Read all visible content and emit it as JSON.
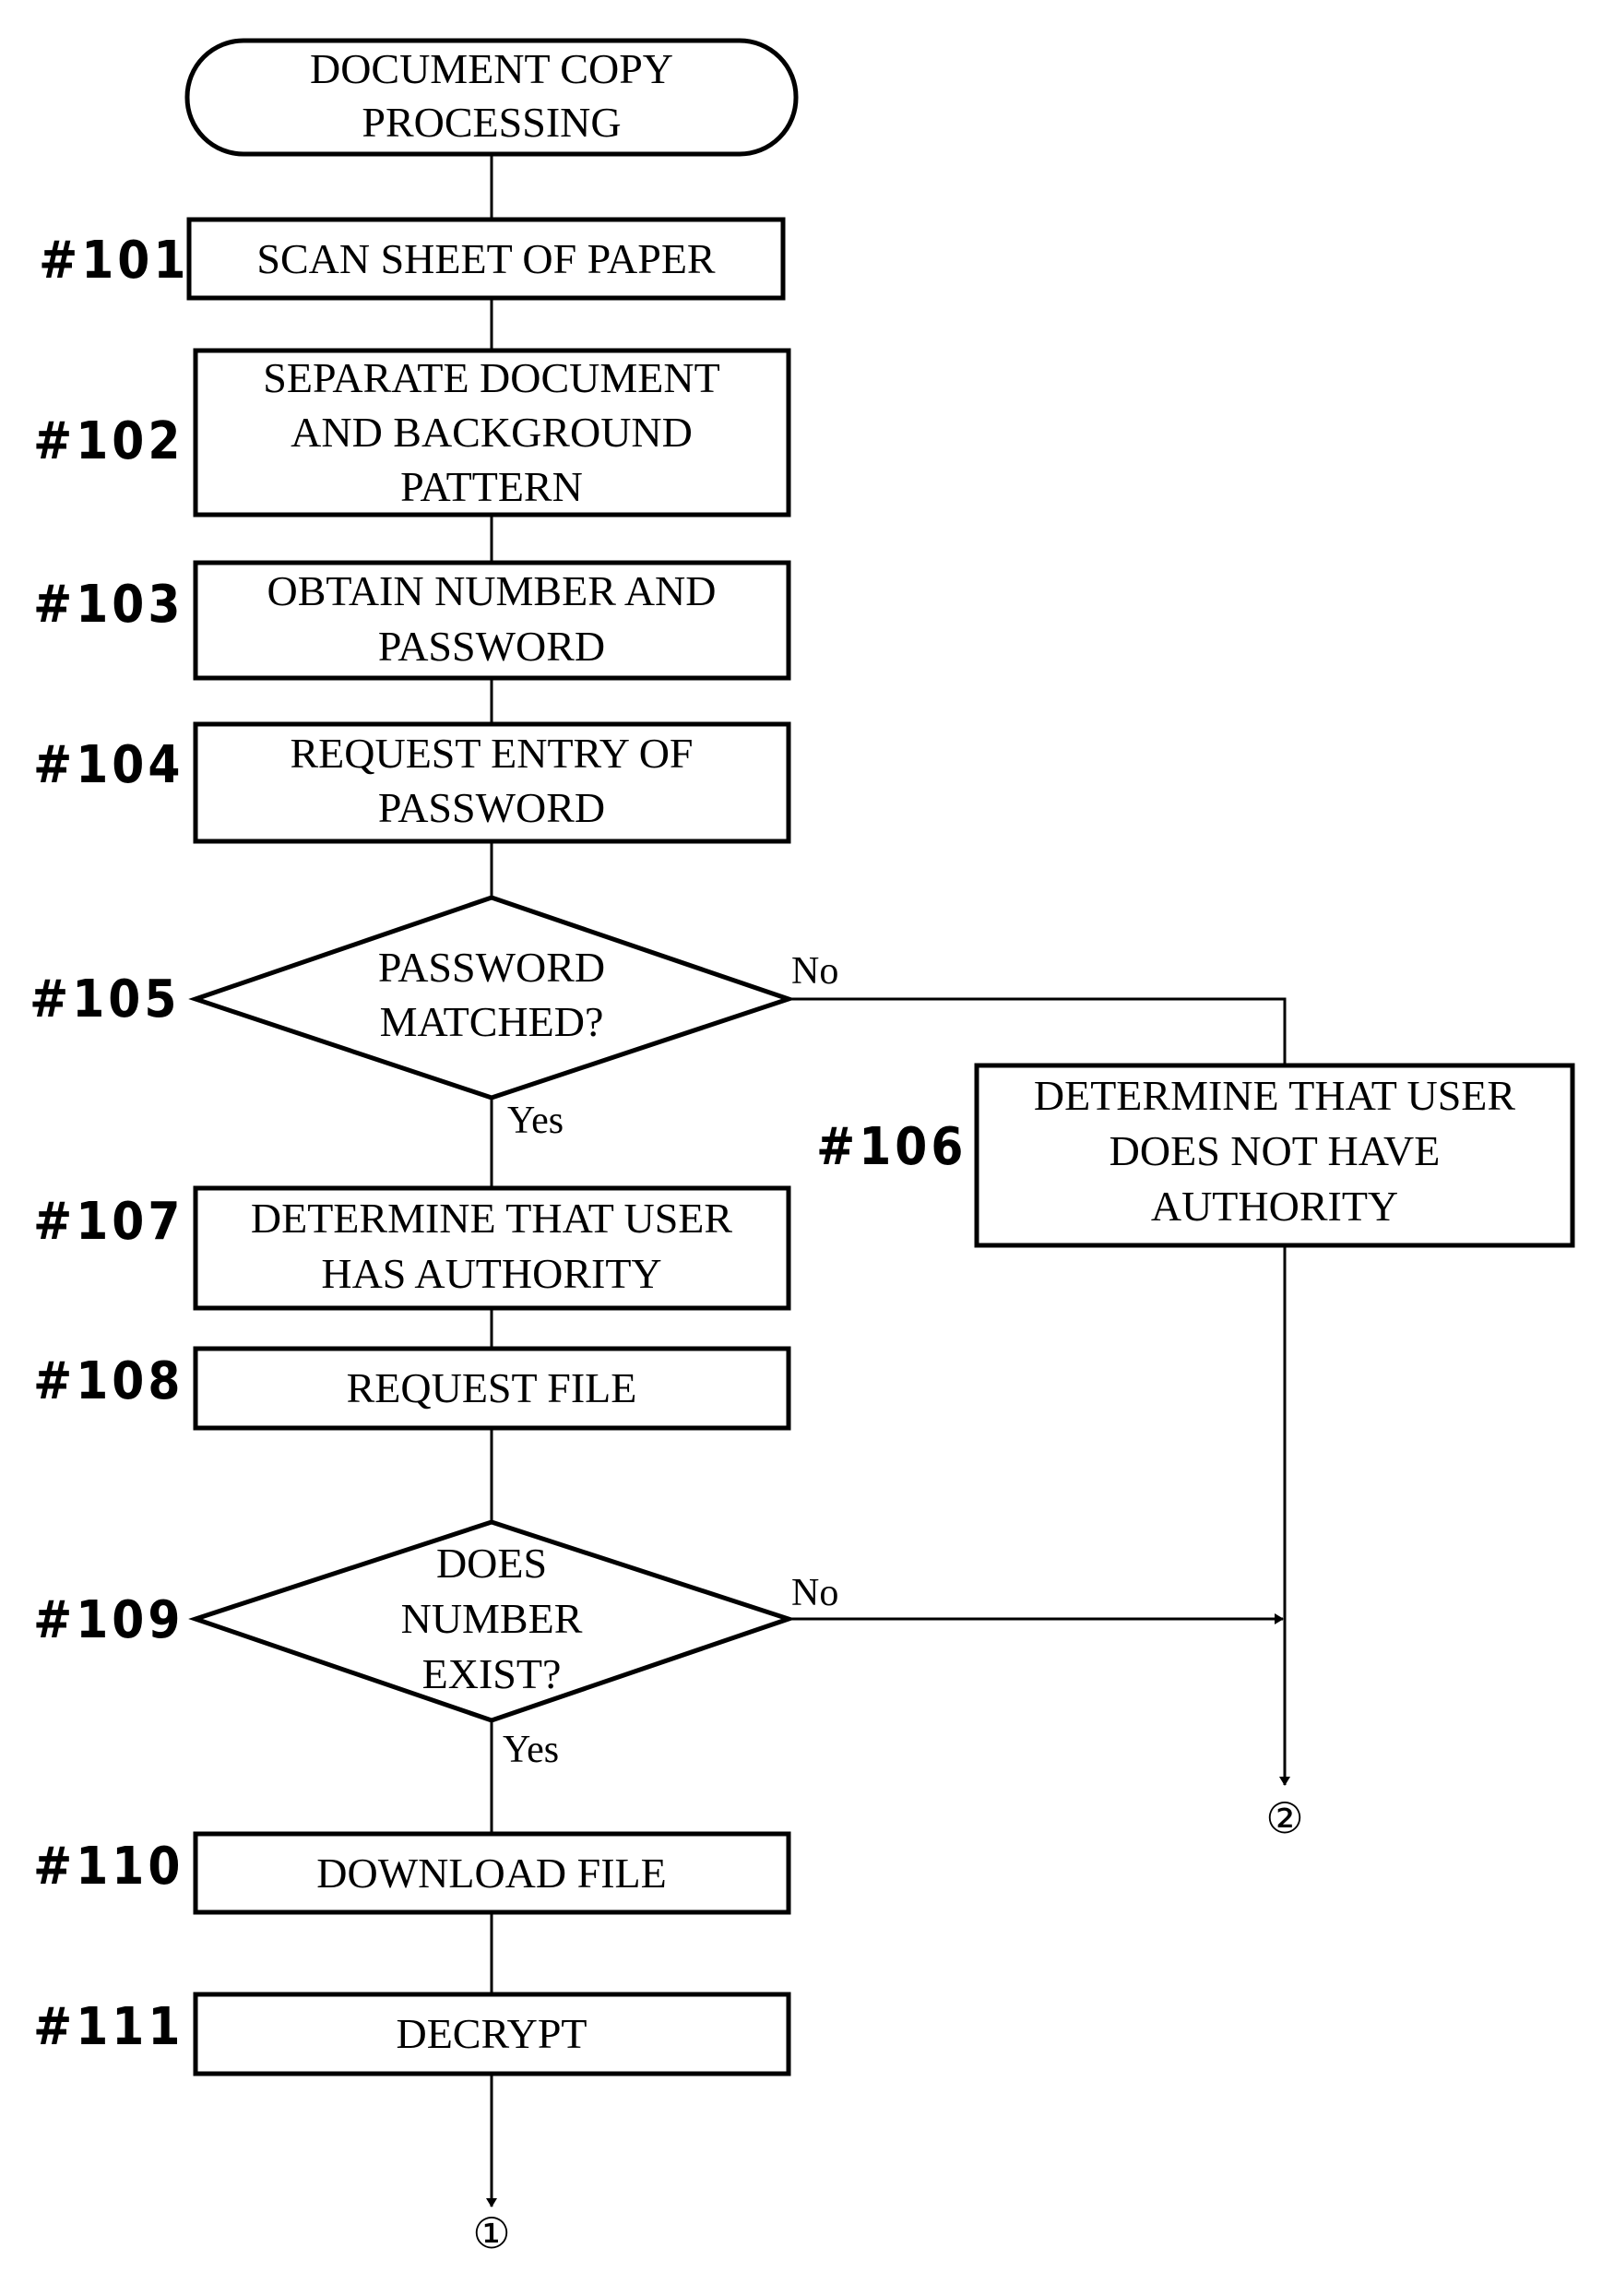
{
  "title": "DOCUMENT COPY PROCESSING",
  "start": {
    "lines": [
      "DOCUMENT COPY",
      "PROCESSING"
    ]
  },
  "steps": [
    {
      "id": "#101",
      "lines": [
        "SCAN SHEET OF PAPER"
      ]
    },
    {
      "id": "#102",
      "lines": [
        "SEPARATE DOCUMENT",
        "AND BACKGROUND",
        "PATTERN"
      ]
    },
    {
      "id": "#103",
      "lines": [
        "OBTAIN NUMBER AND",
        "PASSWORD"
      ]
    },
    {
      "id": "#104",
      "lines": [
        "REQUEST ENTRY OF",
        "PASSWORD"
      ]
    },
    {
      "id": "#105",
      "lines": [
        "PASSWORD",
        "MATCHED?"
      ],
      "type": "decision"
    },
    {
      "id": "#106",
      "lines": [
        "DETERMINE THAT USER",
        "DOES NOT HAVE",
        "AUTHORITY"
      ]
    },
    {
      "id": "#107",
      "lines": [
        "DETERMINE THAT USER",
        "HAS AUTHORITY"
      ]
    },
    {
      "id": "#108",
      "lines": [
        "REQUEST FILE"
      ]
    },
    {
      "id": "#109",
      "lines": [
        "DOES",
        "NUMBER",
        "EXIST?"
      ],
      "type": "decision"
    },
    {
      "id": "#110",
      "lines": [
        "DOWNLOAD FILE"
      ]
    },
    {
      "id": "#111",
      "lines": [
        "DECRYPT"
      ]
    }
  ],
  "branches": {
    "d105_no": "No",
    "d105_yes": "Yes",
    "d109_no": "No",
    "d109_yes": "Yes"
  },
  "connectors": {
    "c1": "①",
    "c2": "②"
  }
}
